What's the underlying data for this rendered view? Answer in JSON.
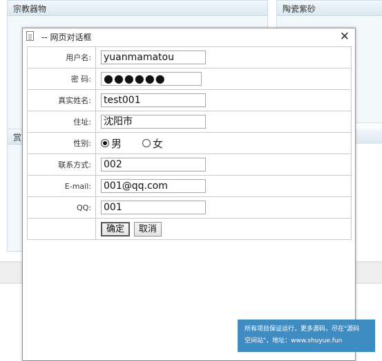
{
  "background": {
    "panel_left_title": "宗教器物",
    "panel_right_title": "陶瓷紫砂",
    "panel_mid_fragment": "赏"
  },
  "dialog": {
    "title": "-- 网页对话框",
    "close_symbol": "✕"
  },
  "form": {
    "fields": [
      {
        "label": "用户名:",
        "value": "yuanmamatou",
        "type": "text"
      },
      {
        "label": "密  码:",
        "value": "●●●●●●",
        "type": "password"
      },
      {
        "label": "真实姓名:",
        "value": "test001",
        "type": "text"
      },
      {
        "label": "住址:",
        "value": "沈阳市",
        "type": "text"
      },
      {
        "label": "性别:",
        "type": "radio"
      },
      {
        "label": "联系方式:",
        "value": "002",
        "type": "text"
      },
      {
        "label": "E-mail:",
        "value": "001@qq.com",
        "type": "text"
      },
      {
        "label": "QQ:",
        "value": "001",
        "type": "text"
      }
    ],
    "gender": {
      "male": "男",
      "female": "女",
      "selected": "male"
    },
    "buttons": {
      "ok": "确定",
      "cancel": "取消"
    }
  },
  "watermark": {
    "line1": "所有项目保证运行，更多源码，尽在\"源码",
    "line2": "空间站\"，地址：www.shuyue.fun"
  }
}
